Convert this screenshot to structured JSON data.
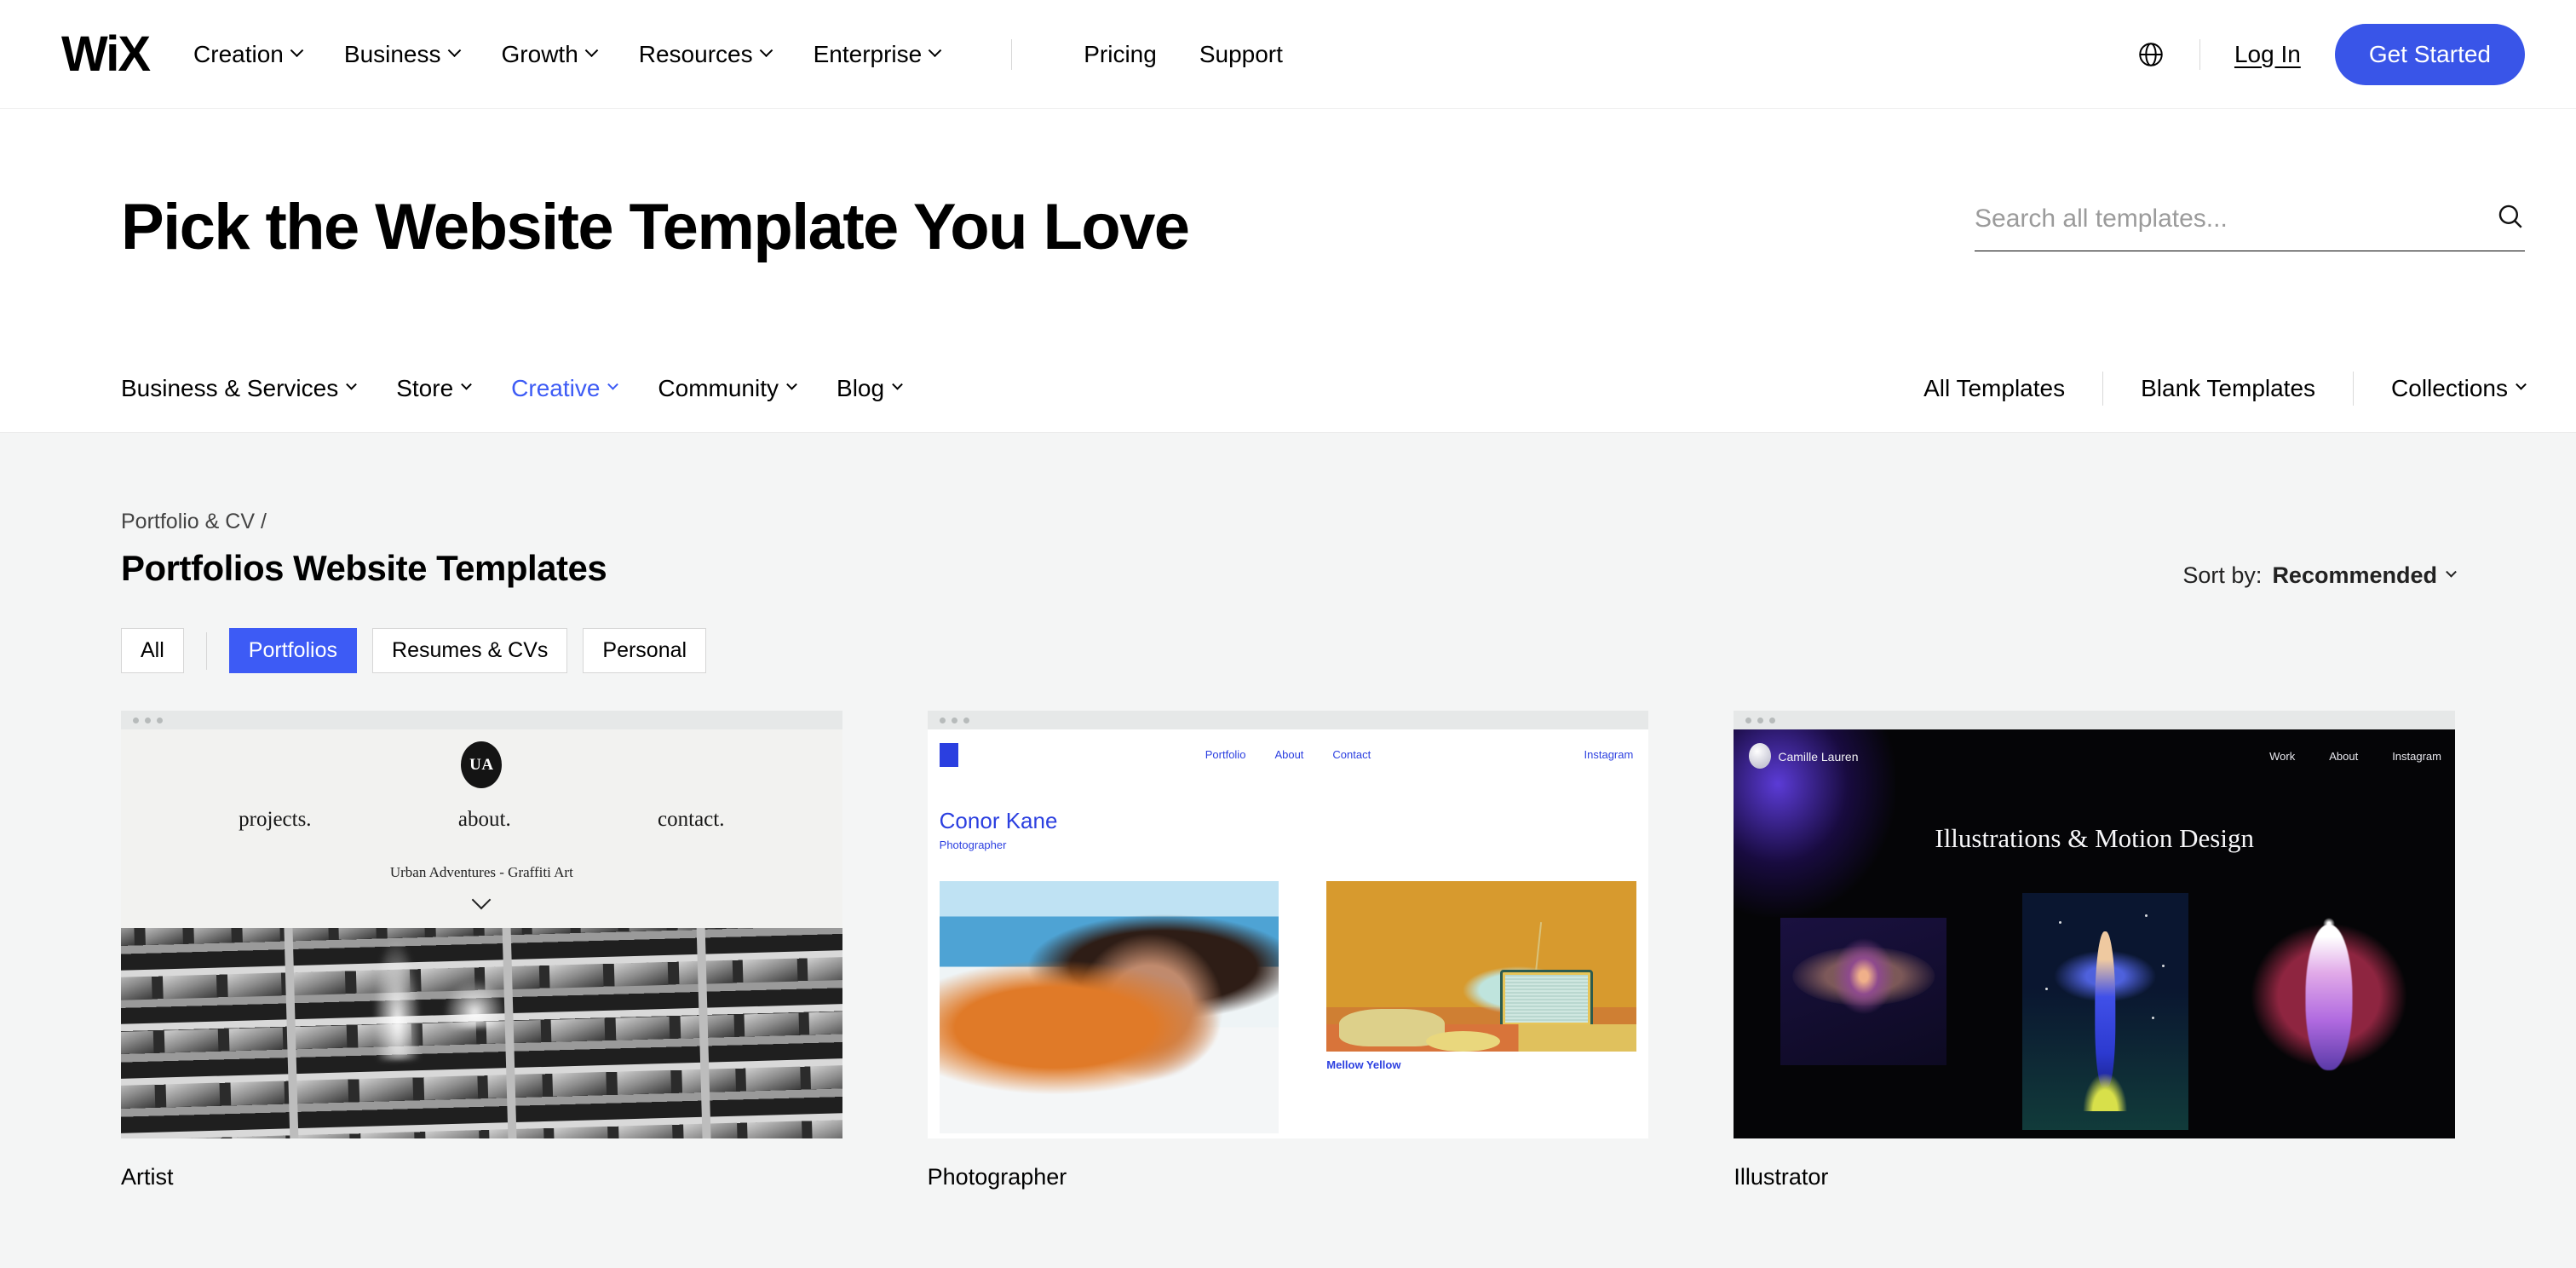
{
  "topbar": {
    "logo": "WiX",
    "nav": [
      {
        "label": "Creation",
        "caret": true
      },
      {
        "label": "Business",
        "caret": true
      },
      {
        "label": "Growth",
        "caret": true
      },
      {
        "label": "Resources",
        "caret": true
      },
      {
        "label": "Enterprise",
        "caret": true
      }
    ],
    "links": [
      {
        "label": "Pricing"
      },
      {
        "label": "Support"
      }
    ],
    "language_icon": "globe-icon",
    "login_label": "Log In",
    "cta_label": "Get Started",
    "accent_color": "#3955e8"
  },
  "hero": {
    "title": "Pick the Website Template You Love",
    "search_placeholder": "Search all templates...",
    "search_value": "",
    "search_icon": "search-icon"
  },
  "catbar": {
    "categories": [
      {
        "label": "Business & Services",
        "active": false
      },
      {
        "label": "Store",
        "active": false
      },
      {
        "label": "Creative",
        "active": true
      },
      {
        "label": "Community",
        "active": false
      },
      {
        "label": "Blog",
        "active": false
      }
    ],
    "right_links": [
      {
        "label": "All Templates",
        "caret": false
      },
      {
        "label": "Blank Templates",
        "caret": false
      },
      {
        "label": "Collections",
        "caret": true
      }
    ],
    "active_color": "#3d5bf5"
  },
  "main": {
    "breadcrumb": "Portfolio & CV /",
    "page_title": "Portfolios Website Templates",
    "sort": {
      "label": "Sort by:",
      "value": "Recommended"
    },
    "filters": [
      {
        "label": "All",
        "selected": false
      },
      {
        "label": "Portfolios",
        "selected": true
      },
      {
        "label": "Resumes & CVs",
        "selected": false
      },
      {
        "label": "Personal",
        "selected": false
      }
    ],
    "cards": [
      {
        "title": "Artist",
        "preview": {
          "logo": "UA",
          "nav": [
            "projects.",
            "about.",
            "contact."
          ],
          "subtitle": "Urban Adventures - Graffiti Art",
          "scroll_icon": "chevron-down-icon",
          "image_description": "black and white apartment building facade"
        }
      },
      {
        "title": "Photographer",
        "preview": {
          "name": "Conor Kane",
          "role": "Photographer",
          "nav": [
            "Portfolio",
            "About",
            "Contact"
          ],
          "social": "Instagram",
          "caption": "Mellow Yellow",
          "image_description": "portrait in orange against blue sky; retro television still life"
        }
      },
      {
        "title": "Illustrator",
        "preview": {
          "name": "Camille Lauren",
          "nav": [
            "Work",
            "About",
            "Instagram"
          ],
          "title": "Illustrations & Motion Design",
          "image_description": "three glowing digital illustrations on black"
        }
      }
    ]
  }
}
